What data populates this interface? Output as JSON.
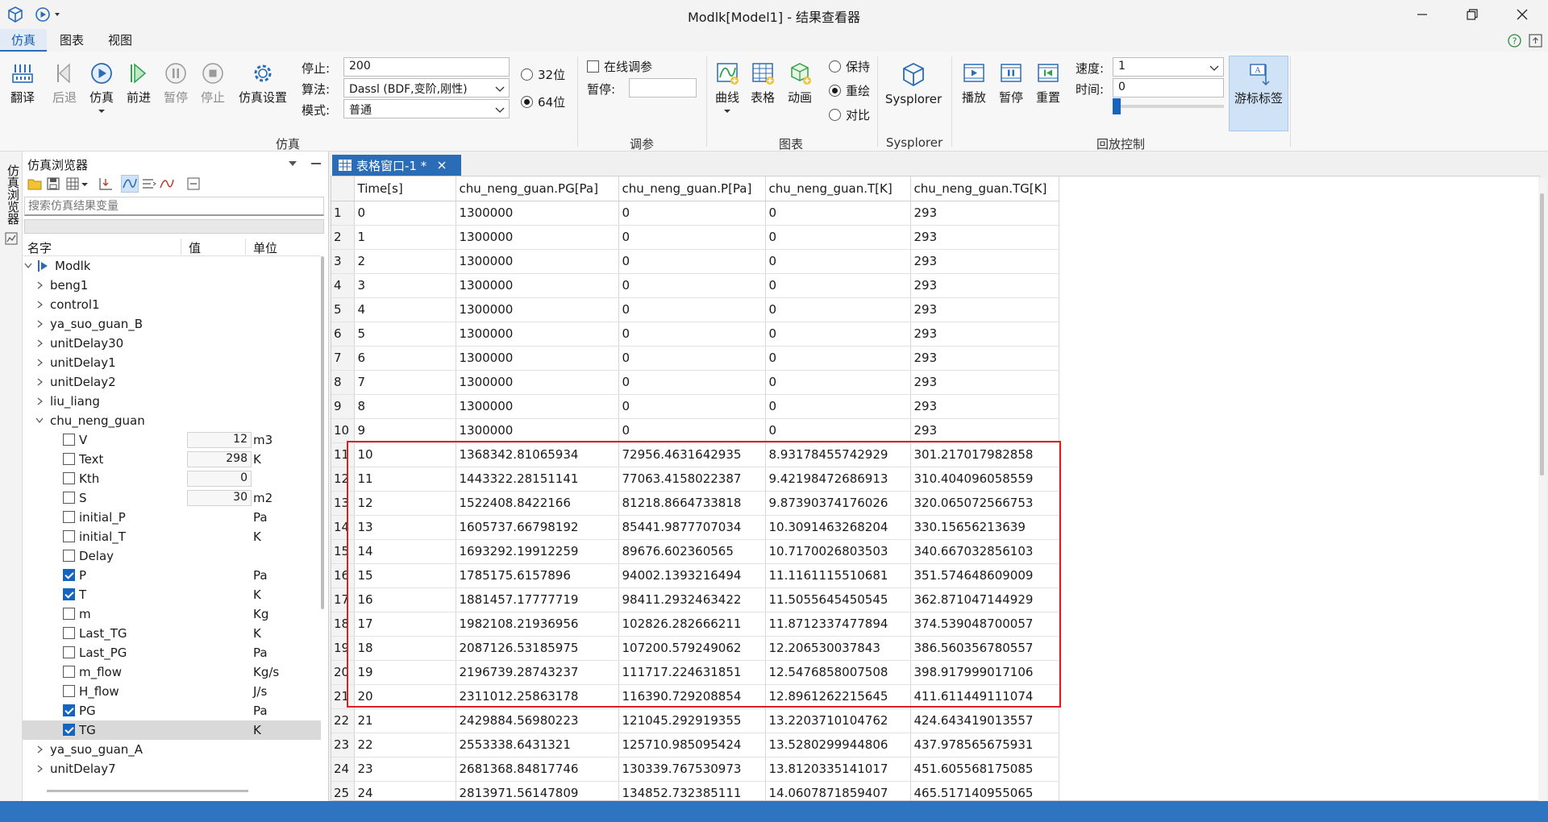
{
  "window": {
    "title": "Modlk[Model1] - 结果查看器"
  },
  "menu": {
    "tabs": [
      "仿真",
      "图表",
      "视图"
    ]
  },
  "ribbon": {
    "sim": {
      "translate": "翻译",
      "back": "后退",
      "simulate": "仿真",
      "forward": "前进",
      "pause": "暂停",
      "stop": "停止",
      "settings": "仿真设置",
      "group": "仿真"
    },
    "params": {
      "stop_label": "停止:",
      "stop_value": "200",
      "algo_label": "算法:",
      "algo_value": "Dassl (BDF,变阶,刚性)",
      "mode_label": "模式:",
      "mode_value": "普通",
      "bit32": "32位",
      "bit64": "64位"
    },
    "tune": {
      "online": "在线调参",
      "pause_label": "暂停:",
      "pause_value": "",
      "group": "调参"
    },
    "charts": {
      "curve": "曲线",
      "table": "表格",
      "animation": "动画",
      "keep": "保持",
      "redraw": "重绘",
      "compare": "对比",
      "group": "图表"
    },
    "sysplorer": {
      "label": "Sysplorer",
      "group": "Sysplorer"
    },
    "playback": {
      "play": "播放",
      "pause": "暂停",
      "reset": "重置",
      "speed_label": "速度:",
      "speed_value": "1",
      "time_label": "时间:",
      "time_value": "0",
      "cursor": "游标标签",
      "group": "回放控制"
    }
  },
  "browser": {
    "side_tab": "仿真浏览器",
    "title": "仿真浏览器",
    "search_placeholder": "搜索仿真结果变量",
    "columns": {
      "name": "名字",
      "value": "值",
      "unit": "单位"
    },
    "root": "Modlk",
    "top_items": [
      "beng1",
      "control1",
      "ya_suo_guan_B",
      "unitDelay30",
      "unitDelay1",
      "unitDelay2",
      "liu_liang"
    ],
    "expanded": "chu_neng_guan",
    "children": [
      {
        "name": "V",
        "value": "12",
        "unit": "m3",
        "checked": false
      },
      {
        "name": "Text",
        "value": "298",
        "unit": "K",
        "checked": false
      },
      {
        "name": "Kth",
        "value": "0",
        "unit": "",
        "checked": false
      },
      {
        "name": "S",
        "value": "30",
        "unit": "m2",
        "checked": false
      },
      {
        "name": "initial_P",
        "value": "",
        "unit": "Pa",
        "checked": false
      },
      {
        "name": "initial_T",
        "value": "",
        "unit": "K",
        "checked": false
      },
      {
        "name": "Delay",
        "value": "",
        "unit": "",
        "checked": false
      },
      {
        "name": "P",
        "value": "",
        "unit": "Pa",
        "checked": true
      },
      {
        "name": "T",
        "value": "",
        "unit": "K",
        "checked": true
      },
      {
        "name": "m",
        "value": "",
        "unit": "Kg",
        "checked": false
      },
      {
        "name": "Last_TG",
        "value": "",
        "unit": "K",
        "checked": false
      },
      {
        "name": "Last_PG",
        "value": "",
        "unit": "Pa",
        "checked": false
      },
      {
        "name": "m_flow",
        "value": "",
        "unit": "Kg/s",
        "checked": false
      },
      {
        "name": "H_flow",
        "value": "",
        "unit": "J/s",
        "checked": false
      },
      {
        "name": "PG",
        "value": "",
        "unit": "Pa",
        "checked": true
      },
      {
        "name": "TG",
        "value": "",
        "unit": "K",
        "checked": true
      }
    ],
    "bottom_items": [
      "ya_suo_guan_A",
      "unitDelay7"
    ]
  },
  "table": {
    "tab_title": "表格窗口-1 *",
    "headers": [
      "Time[s]",
      "chu_neng_guan.PG[Pa]",
      "chu_neng_guan.P[Pa]",
      "chu_neng_guan.T[K]",
      "chu_neng_guan.TG[K]"
    ],
    "rows": [
      [
        "1",
        "0",
        "1300000",
        "0",
        "0",
        "293"
      ],
      [
        "2",
        "1",
        "1300000",
        "0",
        "0",
        "293"
      ],
      [
        "3",
        "2",
        "1300000",
        "0",
        "0",
        "293"
      ],
      [
        "4",
        "3",
        "1300000",
        "0",
        "0",
        "293"
      ],
      [
        "5",
        "4",
        "1300000",
        "0",
        "0",
        "293"
      ],
      [
        "6",
        "5",
        "1300000",
        "0",
        "0",
        "293"
      ],
      [
        "7",
        "6",
        "1300000",
        "0",
        "0",
        "293"
      ],
      [
        "8",
        "7",
        "1300000",
        "0",
        "0",
        "293"
      ],
      [
        "9",
        "8",
        "1300000",
        "0",
        "0",
        "293"
      ],
      [
        "10",
        "9",
        "1300000",
        "0",
        "0",
        "293"
      ],
      [
        "11",
        "10",
        "1368342.81065934",
        "72956.4631642935",
        "8.93178455742929",
        "301.217017982858"
      ],
      [
        "12",
        "11",
        "1443322.28151141",
        "77063.4158022387",
        "9.42198472686913",
        "310.404096058559"
      ],
      [
        "13",
        "12",
        "1522408.8422166",
        "81218.8664733818",
        "9.87390374176026",
        "320.065072566753"
      ],
      [
        "14",
        "13",
        "1605737.66798192",
        "85441.9877707034",
        "10.3091463268204",
        "330.15656213639"
      ],
      [
        "15",
        "14",
        "1693292.19912259",
        "89676.602360565",
        "10.7170026803503",
        "340.667032856103"
      ],
      [
        "16",
        "15",
        "1785175.6157896",
        "94002.1393216494",
        "11.1161115510681",
        "351.574648609009"
      ],
      [
        "17",
        "16",
        "1881457.17777719",
        "98411.2932463422",
        "11.5055645450545",
        "362.871047144929"
      ],
      [
        "18",
        "17",
        "1982108.21936956",
        "102826.282666211",
        "11.8712337477894",
        "374.539048700057"
      ],
      [
        "19",
        "18",
        "2087126.53185975",
        "107200.579249062",
        "12.206530037843",
        "386.560356780557"
      ],
      [
        "20",
        "19",
        "2196739.28743237",
        "111717.224631851",
        "12.5476858007508",
        "398.917999017106"
      ],
      [
        "21",
        "20",
        "2311012.25863178",
        "116390.729208854",
        "12.8961262215645",
        "411.611449111074"
      ],
      [
        "22",
        "21",
        "2429884.56980223",
        "121045.292919355",
        "13.2203710104762",
        "424.643419013557"
      ],
      [
        "23",
        "22",
        "2553338.6431321",
        "125710.985095424",
        "13.5280299944806",
        "437.978565675931"
      ],
      [
        "24",
        "23",
        "2681368.84817746",
        "130339.767530973",
        "13.8120335141017",
        "451.605568175085"
      ],
      [
        "25",
        "24",
        "2813971.56147809",
        "134852.732385111",
        "14.0607871859407",
        "465.517140955065"
      ]
    ]
  },
  "colors": {
    "accent": "#2b6cb6",
    "highlight": "#e01e1e",
    "status": "#2e74c0"
  }
}
